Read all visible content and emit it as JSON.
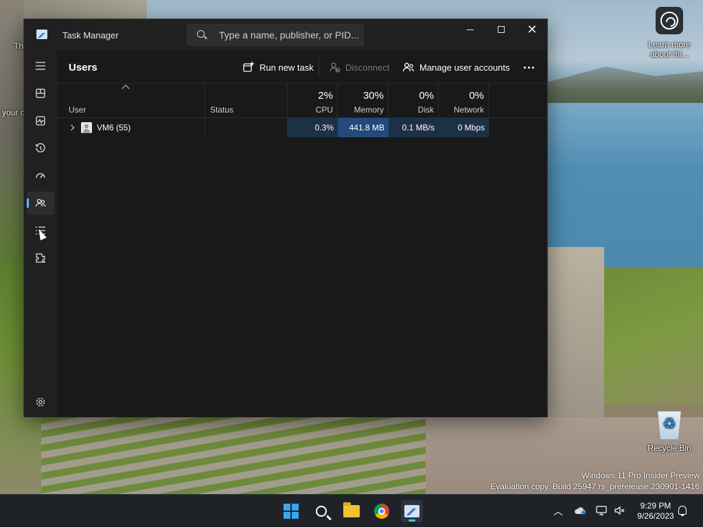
{
  "desktop": {
    "learn_more_label": "Learn more about thi...",
    "recycle_bin_label": "Recycle Bin",
    "partial_labels": [
      "Th",
      "your c"
    ],
    "watermark_line1": "Windows 11 Pro Insider Preview",
    "watermark_line2": "Evaluation copy. Build 25947.rs_prerelease.230901-1416"
  },
  "window": {
    "title": "Task Manager",
    "search_placeholder": "Type a name, publisher, or PID..."
  },
  "nav": {
    "items": [
      {
        "name": "hamburger-menu-icon",
        "active": false
      },
      {
        "name": "processes-icon",
        "active": false
      },
      {
        "name": "performance-icon",
        "active": false
      },
      {
        "name": "app-history-icon",
        "active": false
      },
      {
        "name": "startup-apps-icon",
        "active": false
      },
      {
        "name": "users-icon",
        "active": true
      },
      {
        "name": "details-icon",
        "active": false
      },
      {
        "name": "services-icon",
        "active": false
      }
    ],
    "settings_icon": "settings-icon"
  },
  "toolbar": {
    "page_title": "Users",
    "run_new_task": "Run new task",
    "disconnect": "Disconnect",
    "manage_accounts": "Manage user accounts"
  },
  "table": {
    "columns": {
      "user": "User",
      "status": "Status",
      "cpu": {
        "label": "CPU",
        "pct": "2%"
      },
      "memory": {
        "label": "Memory",
        "pct": "30%"
      },
      "disk": {
        "label": "Disk",
        "pct": "0%"
      },
      "network": {
        "label": "Network",
        "pct": "0%"
      }
    },
    "rows": [
      {
        "user": "VM6 (55)",
        "status": "",
        "cpu": "0.3%",
        "memory": "441.8 MB",
        "disk": "0.1 MB/s",
        "network": "0 Mbps"
      }
    ]
  },
  "taskbar": {
    "time": "9:29 PM",
    "date": "9/26/2023"
  },
  "colors": {
    "accent": "#4cc2ff",
    "window_bg": "#1c1c1c",
    "heat_low": "#1d3046",
    "heat_mid": "#234a7a"
  }
}
